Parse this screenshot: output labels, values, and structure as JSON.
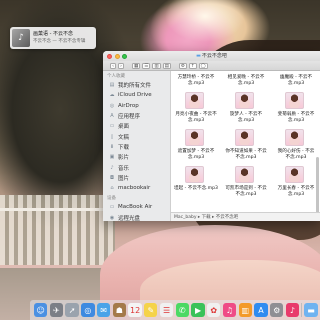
{
  "notification": {
    "title": "画菓语 - 不云不念",
    "subtitle": "不云不念 — 不云不念专辑",
    "icon": "music-note-icon"
  },
  "finder": {
    "window_title": "不云不念吧",
    "toolbar": {
      "buttons": [
        "‹",
        "›",
        "▦",
        "☰",
        "▥",
        "▤",
        "⚙",
        "↑",
        "◯"
      ],
      "icon_names": [
        "back-icon",
        "forward-icon",
        "icon-view-icon",
        "list-view-icon",
        "column-view-icon",
        "cover-flow-icon",
        "action-gear-icon",
        "share-icon",
        "tag-icon"
      ]
    },
    "sidebar": {
      "favorites_header": "个人收藏",
      "favorites": [
        {
          "label": "我的所有文件",
          "icon": "all-files-icon",
          "glyph": "▤"
        },
        {
          "label": "iCloud Drive",
          "icon": "cloud-icon",
          "glyph": "☁"
        },
        {
          "label": "AirDrop",
          "icon": "airdrop-icon",
          "glyph": "◎"
        },
        {
          "label": "应用程序",
          "icon": "applications-icon",
          "glyph": "A"
        },
        {
          "label": "桌面",
          "icon": "desktop-icon",
          "glyph": "▭"
        },
        {
          "label": "文稿",
          "icon": "documents-icon",
          "glyph": "▯"
        },
        {
          "label": "下载",
          "icon": "downloads-icon",
          "glyph": "⬇"
        },
        {
          "label": "影片",
          "icon": "movies-icon",
          "glyph": "▣"
        },
        {
          "label": "音乐",
          "icon": "music-icon",
          "glyph": "♪"
        },
        {
          "label": "图片",
          "icon": "pictures-icon",
          "glyph": "◘"
        },
        {
          "label": "macbookair",
          "icon": "home-icon",
          "glyph": "⌂"
        }
      ],
      "devices_header": "设备",
      "devices": [
        {
          "label": "MacBook Air",
          "icon": "laptop-icon",
          "glyph": "▭"
        },
        {
          "label": "远程光盘",
          "icon": "remote-disc-icon",
          "glyph": "◉"
        }
      ]
    },
    "files": [
      {
        "line1": "方慧玲桥 - 不云不",
        "line2": "念.mp3"
      },
      {
        "line1": "相见爱晚 - 不云不",
        "line2": "念.mp3"
      },
      {
        "line1": "幽魔殿 - 不云不",
        "line2": "念.mp3"
      },
      {
        "line1": "月亮小夜曲 - 不云不",
        "line2": "念.mp3"
      },
      {
        "line1": "旋梦人 - 不云不",
        "line2": "念.mp3"
      },
      {
        "line1": "斐菊弱质 - 不云不",
        "line2": "念.mp3"
      },
      {
        "line1": "遮置加梦 - 不云不",
        "line2": "念.mp3"
      },
      {
        "line1": "你不知道如果 - 不云",
        "line2": "不念.mp3"
      },
      {
        "line1": "我的心好伤 - 不云",
        "line2": "不念.mp3"
      },
      {
        "line1": "坦起 - 不云不念.mp3",
        "line2": ""
      },
      {
        "line1": "可凯市场是到 - 不云",
        "line2": "不念.mp3"
      },
      {
        "line1": "万里长春 - 不云不",
        "line2": "念.mp3"
      }
    ],
    "path_bar": "Mac_baby ▸ 下载 ▸ 不云不念吧"
  },
  "dock": {
    "items": [
      {
        "icon": "finder-icon",
        "glyph": "☺",
        "color": "#4a90e2"
      },
      {
        "icon": "launchpad-icon",
        "glyph": "✈",
        "color": "#7b7f86"
      },
      {
        "icon": "rocket-icon",
        "glyph": "➚",
        "color": "#9aa3ad"
      },
      {
        "icon": "safari-icon",
        "glyph": "◎",
        "color": "#3d8ae0"
      },
      {
        "icon": "mail-icon",
        "glyph": "✉",
        "color": "#4aa3e8"
      },
      {
        "icon": "contacts-icon",
        "glyph": "☗",
        "color": "#a47a4a"
      },
      {
        "icon": "calendar-icon",
        "glyph": "12",
        "color": "#f4f4f4"
      },
      {
        "icon": "notes-icon",
        "glyph": "✎",
        "color": "#f5d34a"
      },
      {
        "icon": "reminders-icon",
        "glyph": "☰",
        "color": "#f0f0f0"
      },
      {
        "icon": "messages-icon",
        "glyph": "✆",
        "color": "#4cd964"
      },
      {
        "icon": "facetime-icon",
        "glyph": "▶",
        "color": "#3ac25a"
      },
      {
        "icon": "photos-icon",
        "glyph": "✿",
        "color": "#f0f0f0"
      },
      {
        "icon": "itunes-icon",
        "glyph": "♫",
        "color": "#ef4b86"
      },
      {
        "icon": "ibooks-icon",
        "glyph": "▥",
        "color": "#f39a2a"
      },
      {
        "icon": "app-store-icon",
        "glyph": "A",
        "color": "#2f8cf0"
      },
      {
        "icon": "system-preferences-icon",
        "glyph": "⚙",
        "color": "#8e8e93"
      },
      {
        "icon": "music-app-icon",
        "glyph": "♪",
        "color": "#e83a6b"
      },
      {
        "icon": "folder-icon",
        "glyph": "▬",
        "color": "#6fb3f0"
      }
    ]
  }
}
